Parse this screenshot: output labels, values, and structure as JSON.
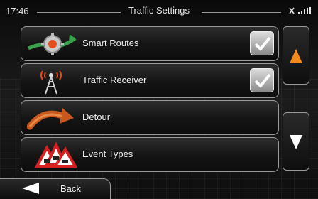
{
  "header": {
    "time": "17:46",
    "title": "Traffic Settings"
  },
  "menu": {
    "items": [
      {
        "label": "Smart Routes",
        "icon": "smart-routes-gear-icon",
        "checked": true
      },
      {
        "label": "Traffic Receiver",
        "icon": "traffic-receiver-antenna-icon",
        "checked": true
      },
      {
        "label": "Detour",
        "icon": "detour-arrow-icon",
        "checked": false
      },
      {
        "label": "Event Types",
        "icon": "warning-signs-icon",
        "checked": false
      }
    ]
  },
  "footer": {
    "back_label": "Back"
  },
  "colors": {
    "accent_orange": "#f08a1c",
    "frame": "#9a9a9a"
  }
}
